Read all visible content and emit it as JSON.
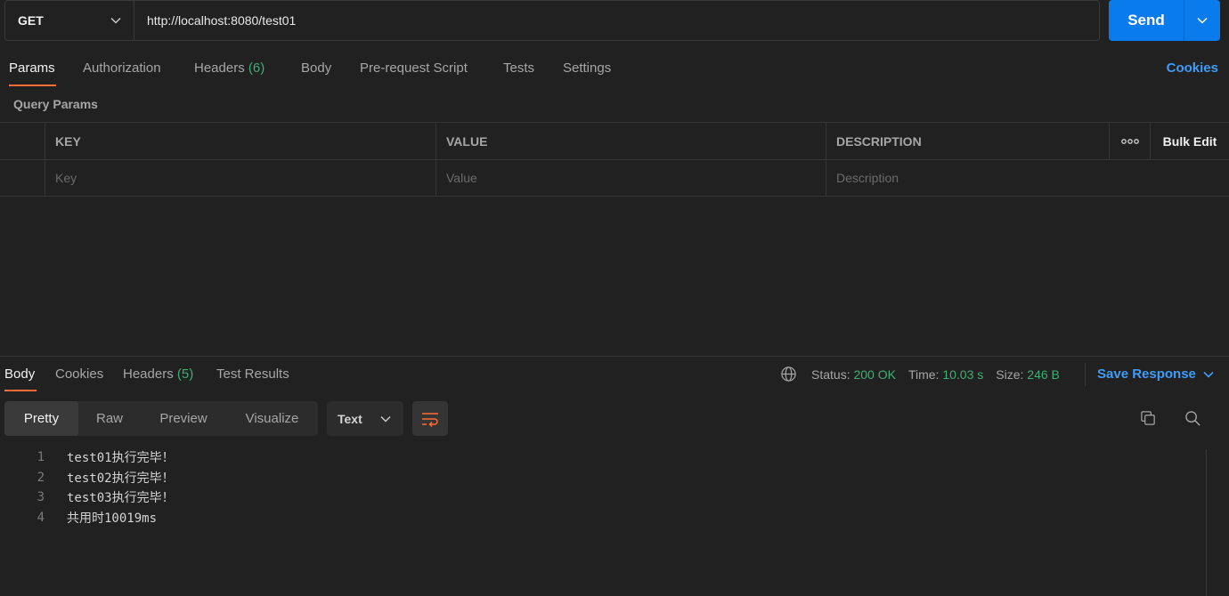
{
  "request": {
    "method": "GET",
    "url": "http://localhost:8080/test01",
    "send_label": "Send"
  },
  "request_tabs": {
    "params": "Params",
    "authorization": "Authorization",
    "headers": "Headers",
    "headers_count": "(6)",
    "body": "Body",
    "prerequest": "Pre-request Script",
    "tests": "Tests",
    "settings": "Settings",
    "cookies": "Cookies"
  },
  "query_params": {
    "title": "Query Params",
    "columns": {
      "key": "KEY",
      "value": "VALUE",
      "description": "DESCRIPTION",
      "more": "ooo",
      "bulk_edit": "Bulk Edit"
    },
    "placeholders": {
      "key": "Key",
      "value": "Value",
      "description": "Description"
    }
  },
  "response_tabs": {
    "body": "Body",
    "cookies": "Cookies",
    "headers": "Headers",
    "headers_count": "(5)",
    "test_results": "Test Results"
  },
  "response_meta": {
    "status_label": "Status:",
    "status_value": "200 OK",
    "time_label": "Time:",
    "time_value": "10.03 s",
    "size_label": "Size:",
    "size_value": "246 B",
    "save_response": "Save Response"
  },
  "view_modes": [
    "Pretty",
    "Raw",
    "Preview",
    "Visualize"
  ],
  "format": "Text",
  "response_lines": [
    {
      "num": "1",
      "text": "test01执行完毕！"
    },
    {
      "num": "2",
      "text": "test02执行完毕！"
    },
    {
      "num": "3",
      "text": "test03执行完毕！"
    },
    {
      "num": "4",
      "text": "共用时10019ms"
    }
  ],
  "colors": {
    "accent_blue": "#097bed",
    "link_blue": "#3f9cf7",
    "active_tab_underline": "#ff6c37",
    "success_green": "#3fae74",
    "background": "#212121"
  },
  "icons": [
    "chevron-down-icon",
    "globe-icon",
    "wrap-lines-icon",
    "copy-icon",
    "search-icon",
    "more-horizontal-icon"
  ]
}
